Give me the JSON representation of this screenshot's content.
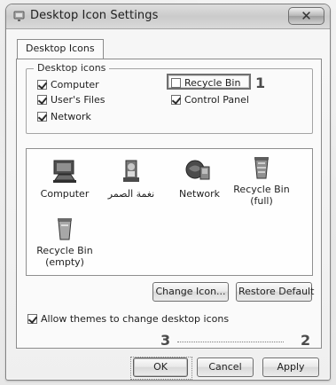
{
  "window": {
    "title": "Desktop Icon Settings",
    "close_label": "✕"
  },
  "tabs": [
    {
      "label": "Desktop Icons"
    }
  ],
  "desktop_icons": {
    "group_title": "Desktop icons",
    "options": [
      {
        "label": "Computer",
        "checked": true
      },
      {
        "label": "User's Files",
        "checked": true
      },
      {
        "label": "Network",
        "checked": true
      },
      {
        "label": "Recycle Bin",
        "checked": false
      },
      {
        "label": "Control Panel",
        "checked": true
      }
    ],
    "marker_1": "1"
  },
  "icon_list": [
    {
      "label": "Computer",
      "icon": "computer-icon"
    },
    {
      "label": "نغمة الصمر",
      "icon": "user-files-icon"
    },
    {
      "label": "Network",
      "icon": "network-icon"
    },
    {
      "label": "Recycle Bin\n(full)",
      "icon": "recycle-bin-full-icon"
    },
    {
      "label": "Recycle Bin\n(empty)",
      "icon": "recycle-bin-empty-icon"
    }
  ],
  "actions": {
    "change_icon": "Change Icon...",
    "restore_default": "Restore Default",
    "allow_themes": "Allow themes to change desktop icons",
    "allow_themes_checked": true
  },
  "footer": {
    "marker_2": "2",
    "marker_3": "3",
    "ok": "OK",
    "cancel": "Cancel",
    "apply": "Apply"
  },
  "colors": {
    "accent_border": "#6f6f6f",
    "panel_bg": "#fafafa",
    "window_bg": "#efefef"
  }
}
